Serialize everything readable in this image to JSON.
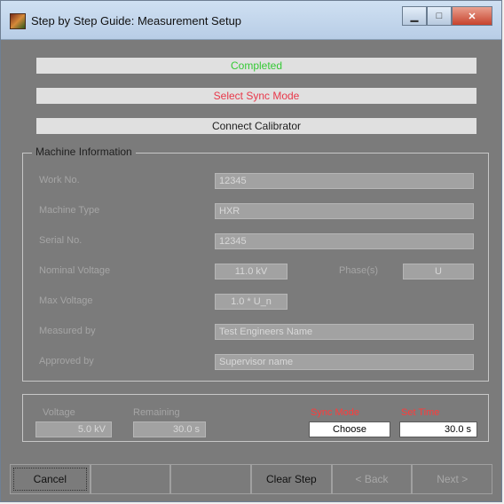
{
  "window": {
    "title": "Step by Step Guide: Measurement Setup"
  },
  "steps": [
    {
      "label": "Completed"
    },
    {
      "label": "Select Sync Mode"
    },
    {
      "label": "Connect Calibrator"
    }
  ],
  "machine": {
    "title": "Machine Information",
    "work_no": {
      "label": "Work No.",
      "value": "12345"
    },
    "machine_type": {
      "label": "Machine Type",
      "value": "HXR"
    },
    "serial_no": {
      "label": "Serial No.",
      "value": "12345"
    },
    "nominal_voltage": {
      "label": "Nominal Voltage",
      "value": "11.0 kV"
    },
    "phases": {
      "label": "Phase(s)",
      "value": "U"
    },
    "max_voltage": {
      "label": "Max Voltage",
      "value": "1.0 * U_n"
    },
    "measured_by": {
      "label": "Measured by",
      "value": "Test Engineers Name"
    },
    "approved_by": {
      "label": "Approved by",
      "value": "Supervisor name"
    }
  },
  "status": {
    "voltage": {
      "label": "Voltage",
      "value": "5.0 kV"
    },
    "remaining": {
      "label": "Remaining",
      "value": "30.0 s"
    },
    "sync_mode": {
      "label": "Sync Mode",
      "value": "Choose"
    },
    "set_time": {
      "label": "Set Time",
      "value": "30.0 s"
    }
  },
  "buttons": {
    "cancel": "Cancel",
    "clear_step": "Clear Step",
    "back": "< Back",
    "next": "Next >"
  },
  "colors": {
    "completed": "#35c935",
    "active_step": "#e8384a",
    "sync_label": "#ff3b3b"
  }
}
